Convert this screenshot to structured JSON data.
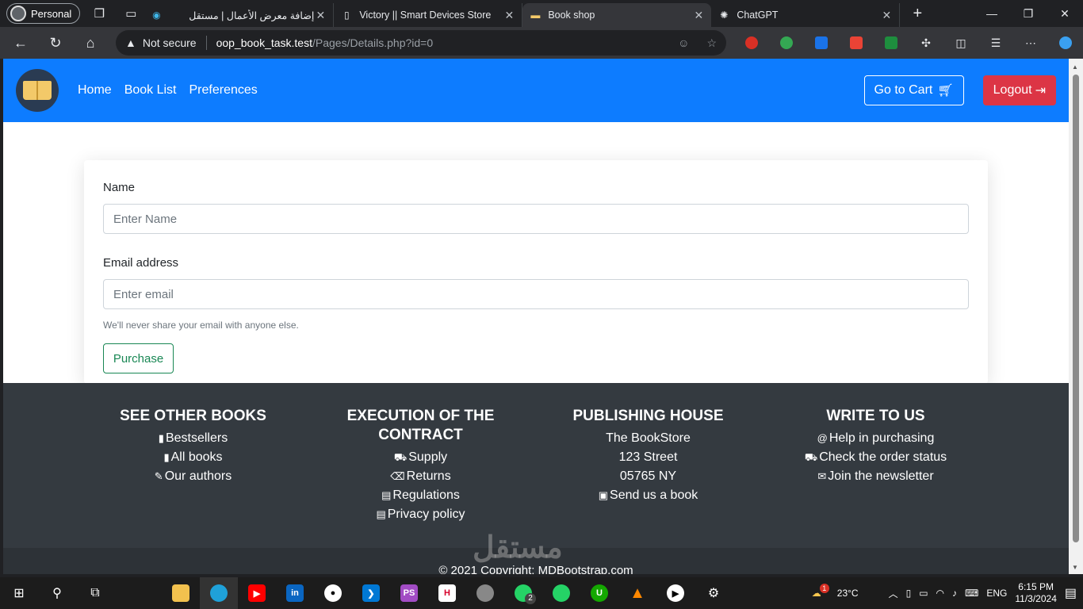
{
  "browser": {
    "profile_label": "Personal",
    "tabs": [
      {
        "title": "إضافة معرض الأعمال | مستقل",
        "close": "✕"
      },
      {
        "title": "Victory || Smart Devices Store",
        "close": "✕"
      },
      {
        "title": "Book shop",
        "close": "✕"
      },
      {
        "title": "ChatGPT",
        "close": "✕"
      }
    ],
    "new_tab": "+",
    "not_secure": "Not secure",
    "url_host": "oop_book_task.test",
    "url_path": "/Pages/Details.php?id=0"
  },
  "nav": {
    "links": [
      "Home",
      "Book List",
      "Preferences"
    ],
    "cart_label": "Go to Cart",
    "logout_label": "Logout"
  },
  "form": {
    "name_label": "Name",
    "name_placeholder": "Enter Name",
    "email_label": "Email address",
    "email_placeholder": "Enter email",
    "email_help": "We'll never share your email with anyone else.",
    "purchase_label": "Purchase"
  },
  "footer": {
    "columns": [
      {
        "heading": "SEE OTHER BOOKS",
        "items": [
          "Bestsellers",
          "All books",
          "Our authors"
        ]
      },
      {
        "heading": "EXECUTION OF THE CONTRACT",
        "items": [
          "Supply",
          "Returns",
          "Regulations",
          "Privacy policy"
        ]
      },
      {
        "heading": "PUBLISHING HOUSE",
        "items": [
          "The BookStore",
          "123 Street",
          "05765 NY",
          "Send us a book"
        ]
      },
      {
        "heading": "WRITE TO US",
        "items": [
          "Help in purchasing",
          "Check the order status",
          "Join the newsletter"
        ]
      }
    ],
    "copyright": "© 2021 Copyright: MDBootstrap.com"
  },
  "watermark": "مستقل",
  "taskbar": {
    "weather": "23°C",
    "language": "ENG",
    "time": "6:15 PM",
    "date": "11/3/2024",
    "whatsapp_badge": "2",
    "weather_badge": "1"
  }
}
